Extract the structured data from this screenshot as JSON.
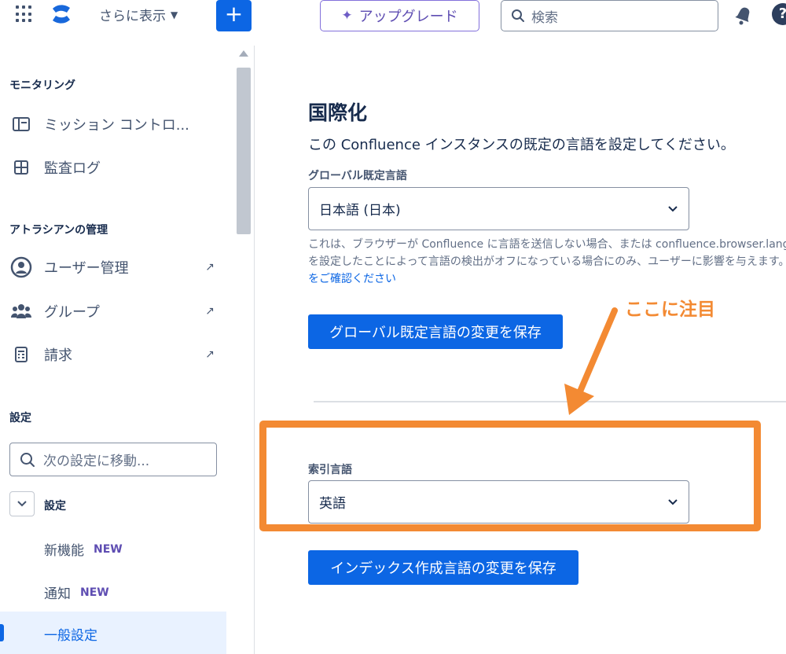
{
  "topbar": {
    "more_label": "さらに表示",
    "create_label": "+",
    "upgrade_label": "アップグレード",
    "search_placeholder": "検索",
    "help_label": "?"
  },
  "sidebar": {
    "monitoring_heading": "モニタリング",
    "monitoring_items": [
      {
        "label": "ミッション コントロ...",
        "icon": "panel-layout-icon"
      },
      {
        "label": "監査ログ",
        "icon": "grid-icon"
      }
    ],
    "atlassian_heading": "アトラシアンの管理",
    "atlassian_items": [
      {
        "label": "ユーザー管理",
        "icon": "person-circle-icon"
      },
      {
        "label": "グループ",
        "icon": "people-group-icon"
      },
      {
        "label": "請求",
        "icon": "document-icon"
      }
    ],
    "external_glyph": "↗",
    "settings_heading": "設定",
    "settings_search_placeholder": "次の設定に移動...",
    "settings_group_label": "設定",
    "sub_items": [
      {
        "label": "新機能",
        "badge": "NEW"
      },
      {
        "label": "通知",
        "badge": "NEW"
      }
    ],
    "active_item": "一般設定"
  },
  "main": {
    "title": "国際化",
    "description": "この Confluence インスタンスの既定の言語を設定してください。",
    "global_language": {
      "label": "グローバル既定言語",
      "value": "日本語 (日本)"
    },
    "help_text_line1": "これは、ブラウザーが Confluence に言語を送信しない場合、または confluence.browser.lang",
    "help_text_line2": "を設定したことによって言語の検出がオフになっている場合にのみ、ユーザーに影響を与えます。こ",
    "help_link": "をご確認ください",
    "save_global_button": "グローバル既定言語の変更を保存",
    "index_language": {
      "label": "索引言語",
      "value": "英語"
    },
    "save_index_button": "インデックス作成言語の変更を保存"
  },
  "annotation": {
    "callout_text": "ここに注目",
    "color": "#f38a33"
  },
  "colors": {
    "primary": "#0c66e4",
    "upgrade": "#5e4db2",
    "text": "#172b4d",
    "subtle": "#44546f"
  }
}
